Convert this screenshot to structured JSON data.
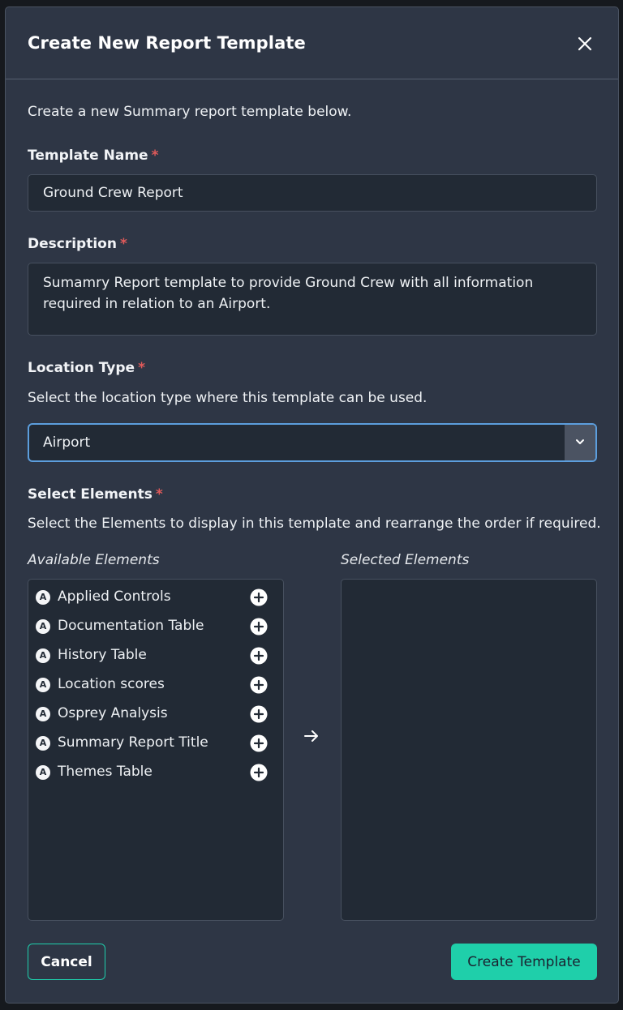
{
  "dialog": {
    "title": "Create New Report Template",
    "subtitle": "Create a new Summary report template below.",
    "required_marker": "*"
  },
  "template_name": {
    "label": "Template Name",
    "value": "Ground Crew Report"
  },
  "description": {
    "label": "Description",
    "value": "Sumamry Report template to provide Ground Crew with all information required in relation to an Airport."
  },
  "location_type": {
    "label": "Location Type",
    "help": "Select the location type where this template can be used.",
    "selected": "Airport"
  },
  "elements": {
    "label": "Select Elements",
    "help": "Select the Elements to display in this template and rearrange the order if required.",
    "available_title": "Available Elements",
    "selected_title": "Selected Elements",
    "badge": "A",
    "available": [
      "Applied Controls",
      "Documentation Table",
      "History Table",
      "Location scores",
      "Osprey Analysis",
      "Summary Report Title",
      "Themes Table"
    ],
    "selected": []
  },
  "footer": {
    "cancel_label": "Cancel",
    "create_label": "Create Template"
  },
  "colors": {
    "accent": "#1fcfaa",
    "required": "#e05a5a",
    "focus": "#5c9edd",
    "dialog_bg": "#2e3645",
    "field_bg": "#222a35"
  },
  "icons": {
    "close": "close-icon",
    "dropdown": "chevron-down-icon",
    "add": "plus-circle-icon",
    "move": "arrow-right-icon"
  }
}
